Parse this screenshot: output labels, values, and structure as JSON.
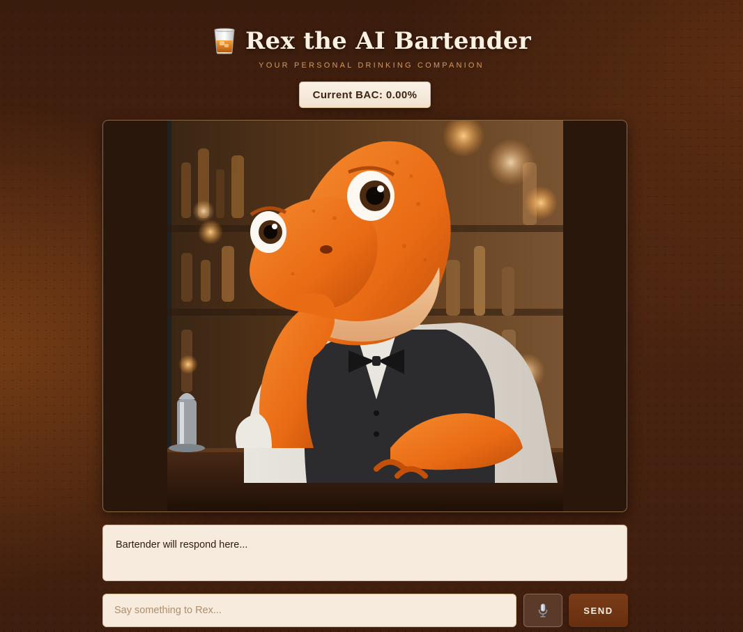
{
  "header": {
    "title": "Rex the AI Bartender",
    "subtitle": "YOUR PERSONAL DRINKING COMPANION",
    "icon": "whiskey-glass-icon"
  },
  "bac": {
    "label": "Current BAC: 0.00%",
    "value": 0.0
  },
  "image": {
    "description": "orange dinosaur bartender in vest and bow tie"
  },
  "response": {
    "text": "Bartender will respond here..."
  },
  "chat": {
    "placeholder": "Say something to Rex...",
    "value": "",
    "mic_icon": "microphone-icon",
    "send_label": "SEND"
  },
  "colors": {
    "background": "#4b2411",
    "accent": "#d19a5e",
    "send_button": "#6e3413",
    "panel": "#f6ebdd"
  }
}
